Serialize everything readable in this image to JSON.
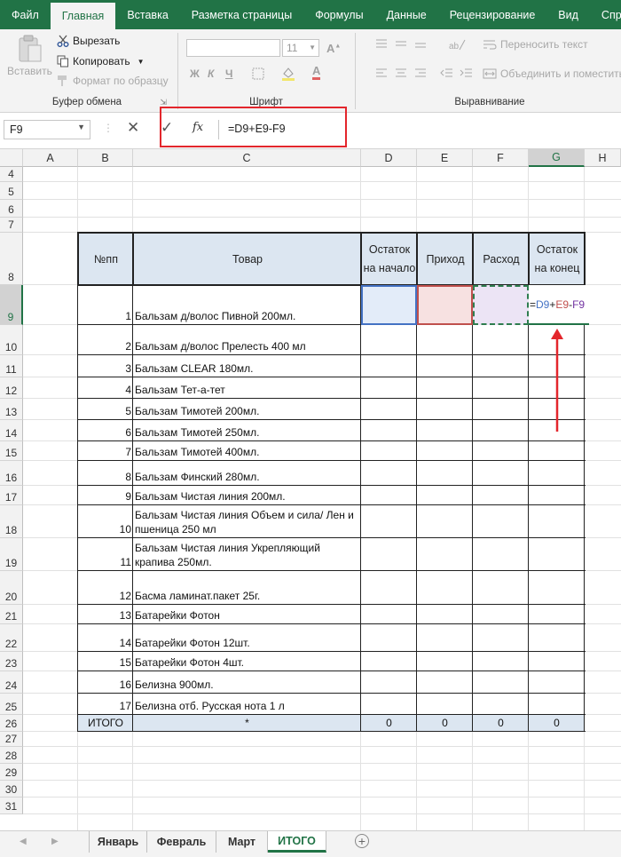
{
  "menu_tabs": [
    "Файл",
    "Главная",
    "Вставка",
    "Разметка страницы",
    "Формулы",
    "Данные",
    "Рецензирование",
    "Вид",
    "Справка"
  ],
  "ribbon": {
    "clipboard": {
      "paste": "Вставить",
      "cut": "Вырезать",
      "copy": "Копировать",
      "format_painter": "Формат по образцу",
      "label": "Буфер обмена"
    },
    "font": {
      "size": "11",
      "bold": "Ж",
      "italic": "К",
      "underline": "Ч",
      "label": "Шрифт"
    },
    "alignment": {
      "wrap": "Переносить текст",
      "merge": "Объединить и поместить",
      "label": "Выравнивание"
    }
  },
  "formula_bar": {
    "name_box": "F9",
    "fx": "fx",
    "formula": "=D9+E9-F9"
  },
  "columns": [
    "A",
    "B",
    "C",
    "D",
    "E",
    "F",
    "G",
    "H"
  ],
  "rows": [
    "4",
    "5",
    "6",
    "7",
    "8",
    "9",
    "10",
    "11",
    "12",
    "13",
    "14",
    "15",
    "16",
    "17",
    "18",
    "19",
    "20",
    "21",
    "22",
    "23",
    "24",
    "25",
    "26",
    "27",
    "28",
    "29",
    "30",
    "31"
  ],
  "table": {
    "headers": {
      "num": "№пп",
      "product": "Товар",
      "start": "Остаток на начало",
      "income": "Приход",
      "expense": "Расход",
      "end": "Остаток на конец"
    },
    "items": [
      {
        "n": "1",
        "name": "Бальзам д/волос Пивной 200мл."
      },
      {
        "n": "2",
        "name": "Бальзам д/волос Прелесть 400 мл"
      },
      {
        "n": "3",
        "name": "Бальзам CLEAR 180мл."
      },
      {
        "n": "4",
        "name": "Бальзам Тет-а-тет"
      },
      {
        "n": "5",
        "name": "Бальзам Тимотей 200мл."
      },
      {
        "n": "6",
        "name": "Бальзам Тимотей 250мл."
      },
      {
        "n": "7",
        "name": "Бальзам Тимотей 400мл."
      },
      {
        "n": "8",
        "name": "Бальзам Финский 280мл."
      },
      {
        "n": "9",
        "name": "Бальзам Чистая линия 200мл."
      },
      {
        "n": "10",
        "name": "Бальзам Чистая линия Объем и сила/ Лен и пшеница 250 мл"
      },
      {
        "n": "11",
        "name": "Бальзам Чистая линия Укрепляющий крапива 250мл."
      },
      {
        "n": "12",
        "name": "Басма ламинат.пакет 25г."
      },
      {
        "n": "13",
        "name": "Батарейки Фотон"
      },
      {
        "n": "14",
        "name": "Батарейки Фотон 12шт."
      },
      {
        "n": "15",
        "name": "Батарейки Фотон 4шт."
      },
      {
        "n": "16",
        "name": "Белизна 900мл."
      },
      {
        "n": "17",
        "name": "Белизна отб. Русская нота 1 л"
      }
    ],
    "editing_formula": {
      "eq": "=",
      "d": "D9",
      "plus": "+",
      "e": "E9",
      "minus": "-",
      "f": "F9"
    },
    "total": {
      "label": "ИТОГО",
      "star": "*",
      "d": "0",
      "e": "0",
      "f": "0",
      "g": "0"
    }
  },
  "sheet_tabs": [
    "Январь",
    "Февраль",
    "Март",
    "ИТОГО"
  ],
  "colors": {
    "excel_green": "#217346",
    "header_fill": "#dce6f1",
    "ref_d": "#4472c4",
    "ref_e": "#c0504d",
    "ref_f": "#7030a0",
    "annotation": "#e3262c"
  }
}
